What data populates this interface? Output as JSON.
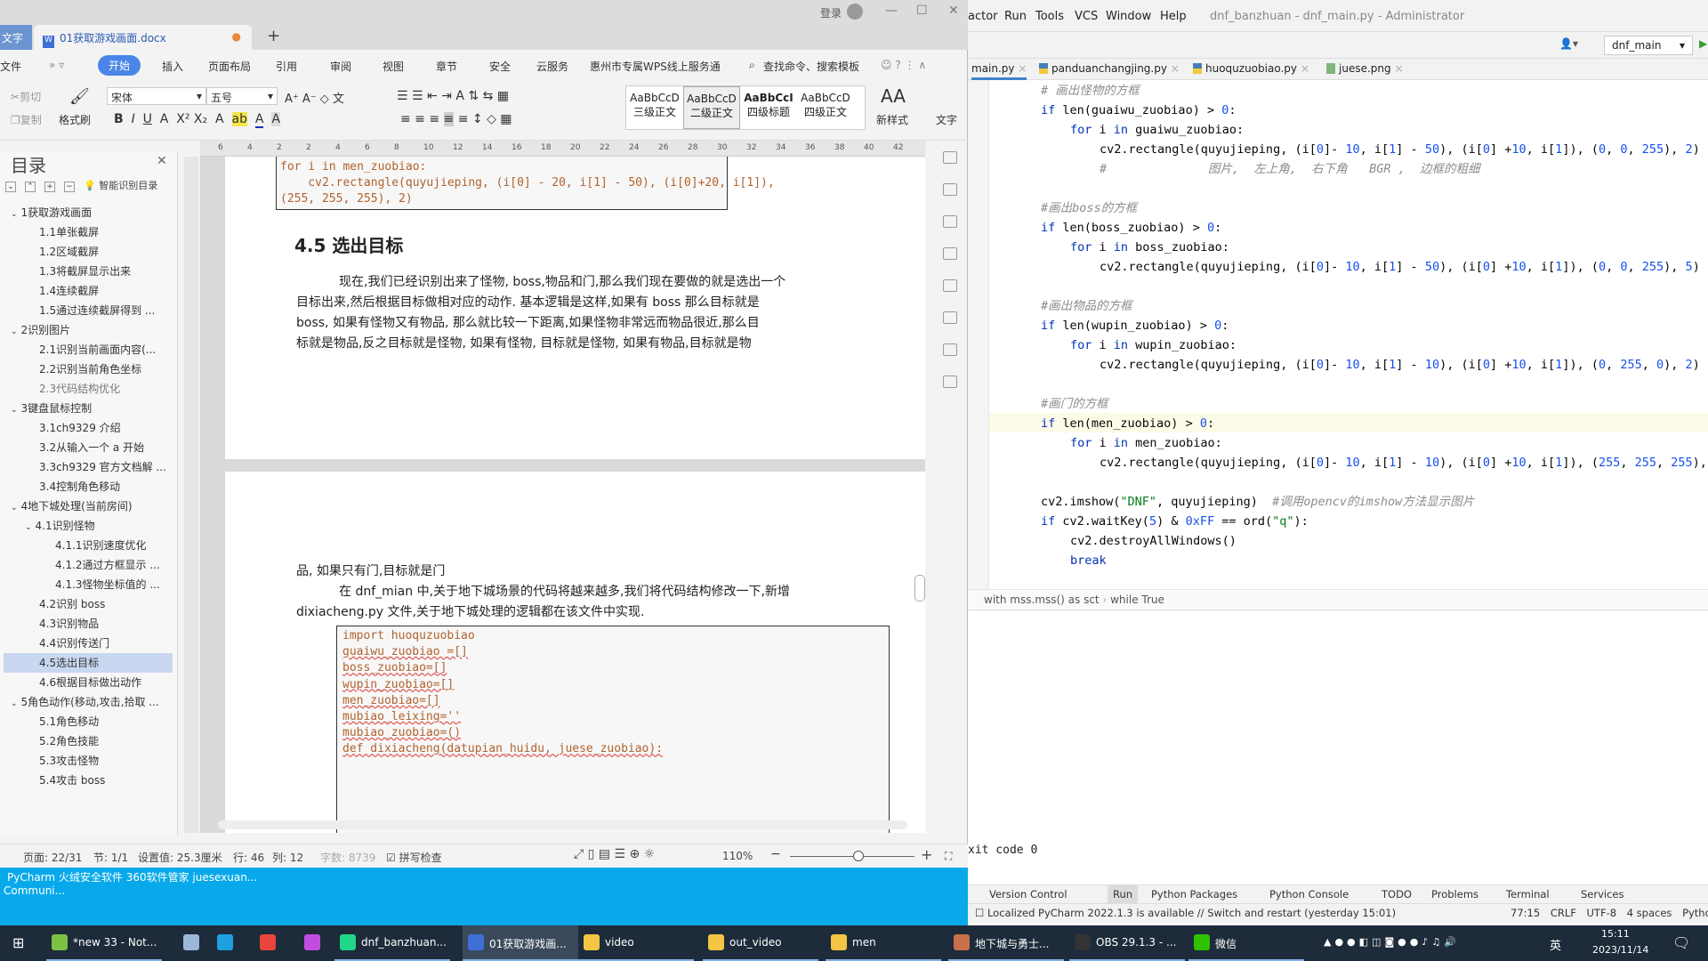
{
  "wps": {
    "app_tab": "文字",
    "doc_tab": "01获取游戏画面.docx",
    "login": "登录",
    "menu": [
      "文件",
      "开始",
      "插入",
      "页面布局",
      "引用",
      "审阅",
      "视图",
      "章节",
      "安全",
      "云服务",
      "惠州市专属WPS线上服务通"
    ],
    "search": "查找命令、搜索模板",
    "ribbon": {
      "cut": "剪切",
      "copy": "复制",
      "format_painter": "格式刷",
      "font": "宋体",
      "size": "五号",
      "styles": [
        {
          "sample": "AaBbCcD",
          "name": "三级正文"
        },
        {
          "sample": "AaBbCcD",
          "name": "二级正文"
        },
        {
          "sample": "AaBbCcI",
          "name": "四级标题"
        },
        {
          "sample": "AaBbCcD",
          "name": "四级正文"
        }
      ],
      "new_style": "新样式",
      "text_tool": "文字"
    },
    "ruler": [
      "6",
      "4",
      "2",
      "2",
      "4",
      "6",
      "8",
      "10",
      "12",
      "14",
      "16",
      "18",
      "20",
      "22",
      "24",
      "26",
      "28",
      "30",
      "32",
      "34",
      "36",
      "38",
      "40",
      "42"
    ],
    "nav": {
      "title": "目录",
      "smart": "智能识别目录",
      "items": [
        {
          "label": "1获取游戏画面",
          "level": 1,
          "caret": true
        },
        {
          "label": "1.1单张截屏",
          "level": 2
        },
        {
          "label": "1.2区域截屏",
          "level": 2
        },
        {
          "label": "1.3将截屏显示出来",
          "level": 2
        },
        {
          "label": "1.4连续截屏",
          "level": 2
        },
        {
          "label": "1.5通过连续截屏得到 ...",
          "level": 2
        },
        {
          "label": "2识别图片",
          "level": 1,
          "caret": true
        },
        {
          "label": "2.1识别当前画面内容(...",
          "level": 2
        },
        {
          "label": "2.2识别当前角色坐标",
          "level": 2
        },
        {
          "label": "2.3代码结构优化",
          "level": 2
        },
        {
          "label": "3键盘鼠标控制",
          "level": 1,
          "caret": true
        },
        {
          "label": "3.1ch9329 介绍",
          "level": 2
        },
        {
          "label": "3.2从输入一个 a 开始",
          "level": 2
        },
        {
          "label": "3.3ch9329 官方文档解 ...",
          "level": 2
        },
        {
          "label": "3.4控制角色移动",
          "level": 2
        },
        {
          "label": "4地下城处理(当前房间)",
          "level": 1,
          "caret": true
        },
        {
          "label": "4.1识别怪物",
          "level": 2,
          "caret": true
        },
        {
          "label": "4.1.1识别速度优化",
          "level": 3
        },
        {
          "label": "4.1.2通过方框显示 ...",
          "level": 3
        },
        {
          "label": "4.1.3怪物坐标值的 ...",
          "level": 3
        },
        {
          "label": "4.2识别 boss",
          "level": 2
        },
        {
          "label": "4.3识别物品",
          "level": 2
        },
        {
          "label": "4.4识别传送门",
          "level": 2
        },
        {
          "label": "4.5选出目标",
          "level": 2,
          "selected": true
        },
        {
          "label": "4.6根据目标做出动作",
          "level": 2
        },
        {
          "label": "5角色动作(移动,攻击,拾取 ...",
          "level": 1,
          "caret": true
        },
        {
          "label": "5.1角色移动",
          "level": 2
        },
        {
          "label": "5.2角色技能",
          "level": 2
        },
        {
          "label": "5.3攻击怪物",
          "level": 2
        },
        {
          "label": "5.4攻击 boss",
          "level": 2
        }
      ]
    },
    "page1": {
      "code_top": "for i in men_zuobiao:",
      "code1": "    cv2.rectangle(quyujieping, (i[0] - 20, i[1] - 50), (i[0]+20, i[1]),",
      "code2": "(255, 255, 255), 2)",
      "heading": "4.5  选出目标",
      "para": [
        "现在,我们已经识别出来了怪物, boss,物品和门,那么我们现在要做的就是选出一个",
        "目标出来,然后根据目标做相对应的动作. 基本逻辑是这样,如果有 boss 那么目标就是",
        "boss,   如果有怪物又有物品, 那么就比较一下距离,如果怪物非常远而物品很近,那么目",
        "标就是物品,反之目标就是怪物, 如果有怪物, 目标就是怪物,    如果有物品,目标就是物"
      ]
    },
    "page2": {
      "para": [
        "品, 如果只有门,目标就是门",
        "在 dnf_mian 中,关于地下城场景的代码将越来越多,我们将代码结构修改一下,新增",
        "dixiacheng.py 文件,关于地下城处理的逻辑都在该文件中实现."
      ],
      "code": [
        "import huoquzuobiao",
        "",
        "",
        "guaiwu_zuobiao =[]",
        "boss_zuobiao=[]",
        "wupin_zuobiao=[]",
        "men_zuobiao=[]",
        "",
        "mubiao_leixing=''",
        "mubiao_zuobiao=()",
        "",
        "",
        "def dixiacheng(datupian_huidu, juese_zuobiao):"
      ]
    },
    "status": {
      "pages": "页面: 22/31",
      "section": "节: 1/1",
      "setting": "设置值: 25.3厘米",
      "row": "行: 46",
      "col": "列: 12",
      "words": "字数: 8739",
      "spell": "拼写检查",
      "zoom": "110%",
      "zoom_level": 0.55
    }
  },
  "desktop": {
    "line1": "PyCharm    火绒安全软件  360软件管家  juesexuan...",
    "line2": "Communi..."
  },
  "pycharm": {
    "menu": [
      "actor",
      "Run",
      "Tools",
      "VCS",
      "Window",
      "Help"
    ],
    "title": "dnf_banzhuan - dnf_main.py - Administrator",
    "run_config": "dnf_main",
    "tabs": [
      "main.py",
      "panduanchangjing.py",
      "huoquzuobiao.py",
      "juese.png"
    ],
    "breadcrumb": [
      "with mss.mss() as sct",
      "while True"
    ],
    "run_output": "xit code 0",
    "tool_windows": [
      "Version Control",
      "Run",
      "Python Packages",
      "Python Console",
      "TODO",
      "Problems",
      "Terminal",
      "Services"
    ],
    "notice": "Localized PyCharm 2022.1.3 is available // Switch and restart (yesterday 15:01)",
    "status_right": [
      "77:15",
      "CRLF",
      "UTF-8",
      "4 spaces",
      "Pytho"
    ]
  },
  "taskbar": {
    "items": [
      {
        "label": "*new 33 - Not...",
        "color": "#7cc242"
      },
      {
        "label": "",
        "color": "#9bb7d8"
      },
      {
        "label": "",
        "color": "#1fa0e0"
      },
      {
        "label": "",
        "color": "#e8453c"
      },
      {
        "label": "",
        "color": "#c04de0"
      },
      {
        "label": "dnf_banzhuan...",
        "color": "#21d789"
      },
      {
        "label": "01获取游戏画...",
        "color": "#3d6fd6",
        "active": true
      },
      {
        "label": "video",
        "color": "#f4c542"
      },
      {
        "label": "out_video",
        "color": "#f4c542"
      },
      {
        "label": "men",
        "color": "#f4c542"
      },
      {
        "label": "地下城与勇士...",
        "color": "#c9704a"
      },
      {
        "label": "OBS 29.1.3 - ...",
        "color": "#333"
      },
      {
        "label": "微信",
        "color": "#2dc100"
      }
    ],
    "ime": "英",
    "time": "15:11",
    "date": "2023/11/14"
  }
}
